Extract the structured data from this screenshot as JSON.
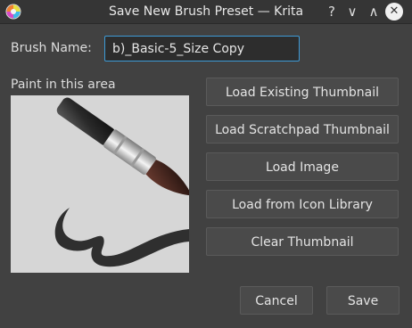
{
  "window": {
    "title": "Save New Brush Preset — Krita",
    "help_glyph": "?",
    "minimize_glyph": "∨",
    "maximize_glyph": "∧",
    "close_glyph": "✕",
    "app_icon": "krita-icon"
  },
  "form": {
    "brush_name_label": "Brush Name:",
    "brush_name_value": "b)_Basic-5_Size Copy"
  },
  "paint_area": {
    "label": "Paint in this area",
    "thumbnail": "brush-thumbnail"
  },
  "actions": {
    "load_existing": "Load Existing Thumbnail",
    "load_scratchpad": "Load Scratchpad Thumbnail",
    "load_image": "Load Image",
    "load_icon_library": "Load from Icon Library",
    "clear_thumbnail": "Clear Thumbnail"
  },
  "footer": {
    "cancel": "Cancel",
    "save": "Save"
  },
  "colors": {
    "window_bg": "#414141",
    "titlebar_bg": "#353535",
    "input_focus": "#3d9ad6",
    "paint_bg": "#d6d6d6"
  }
}
